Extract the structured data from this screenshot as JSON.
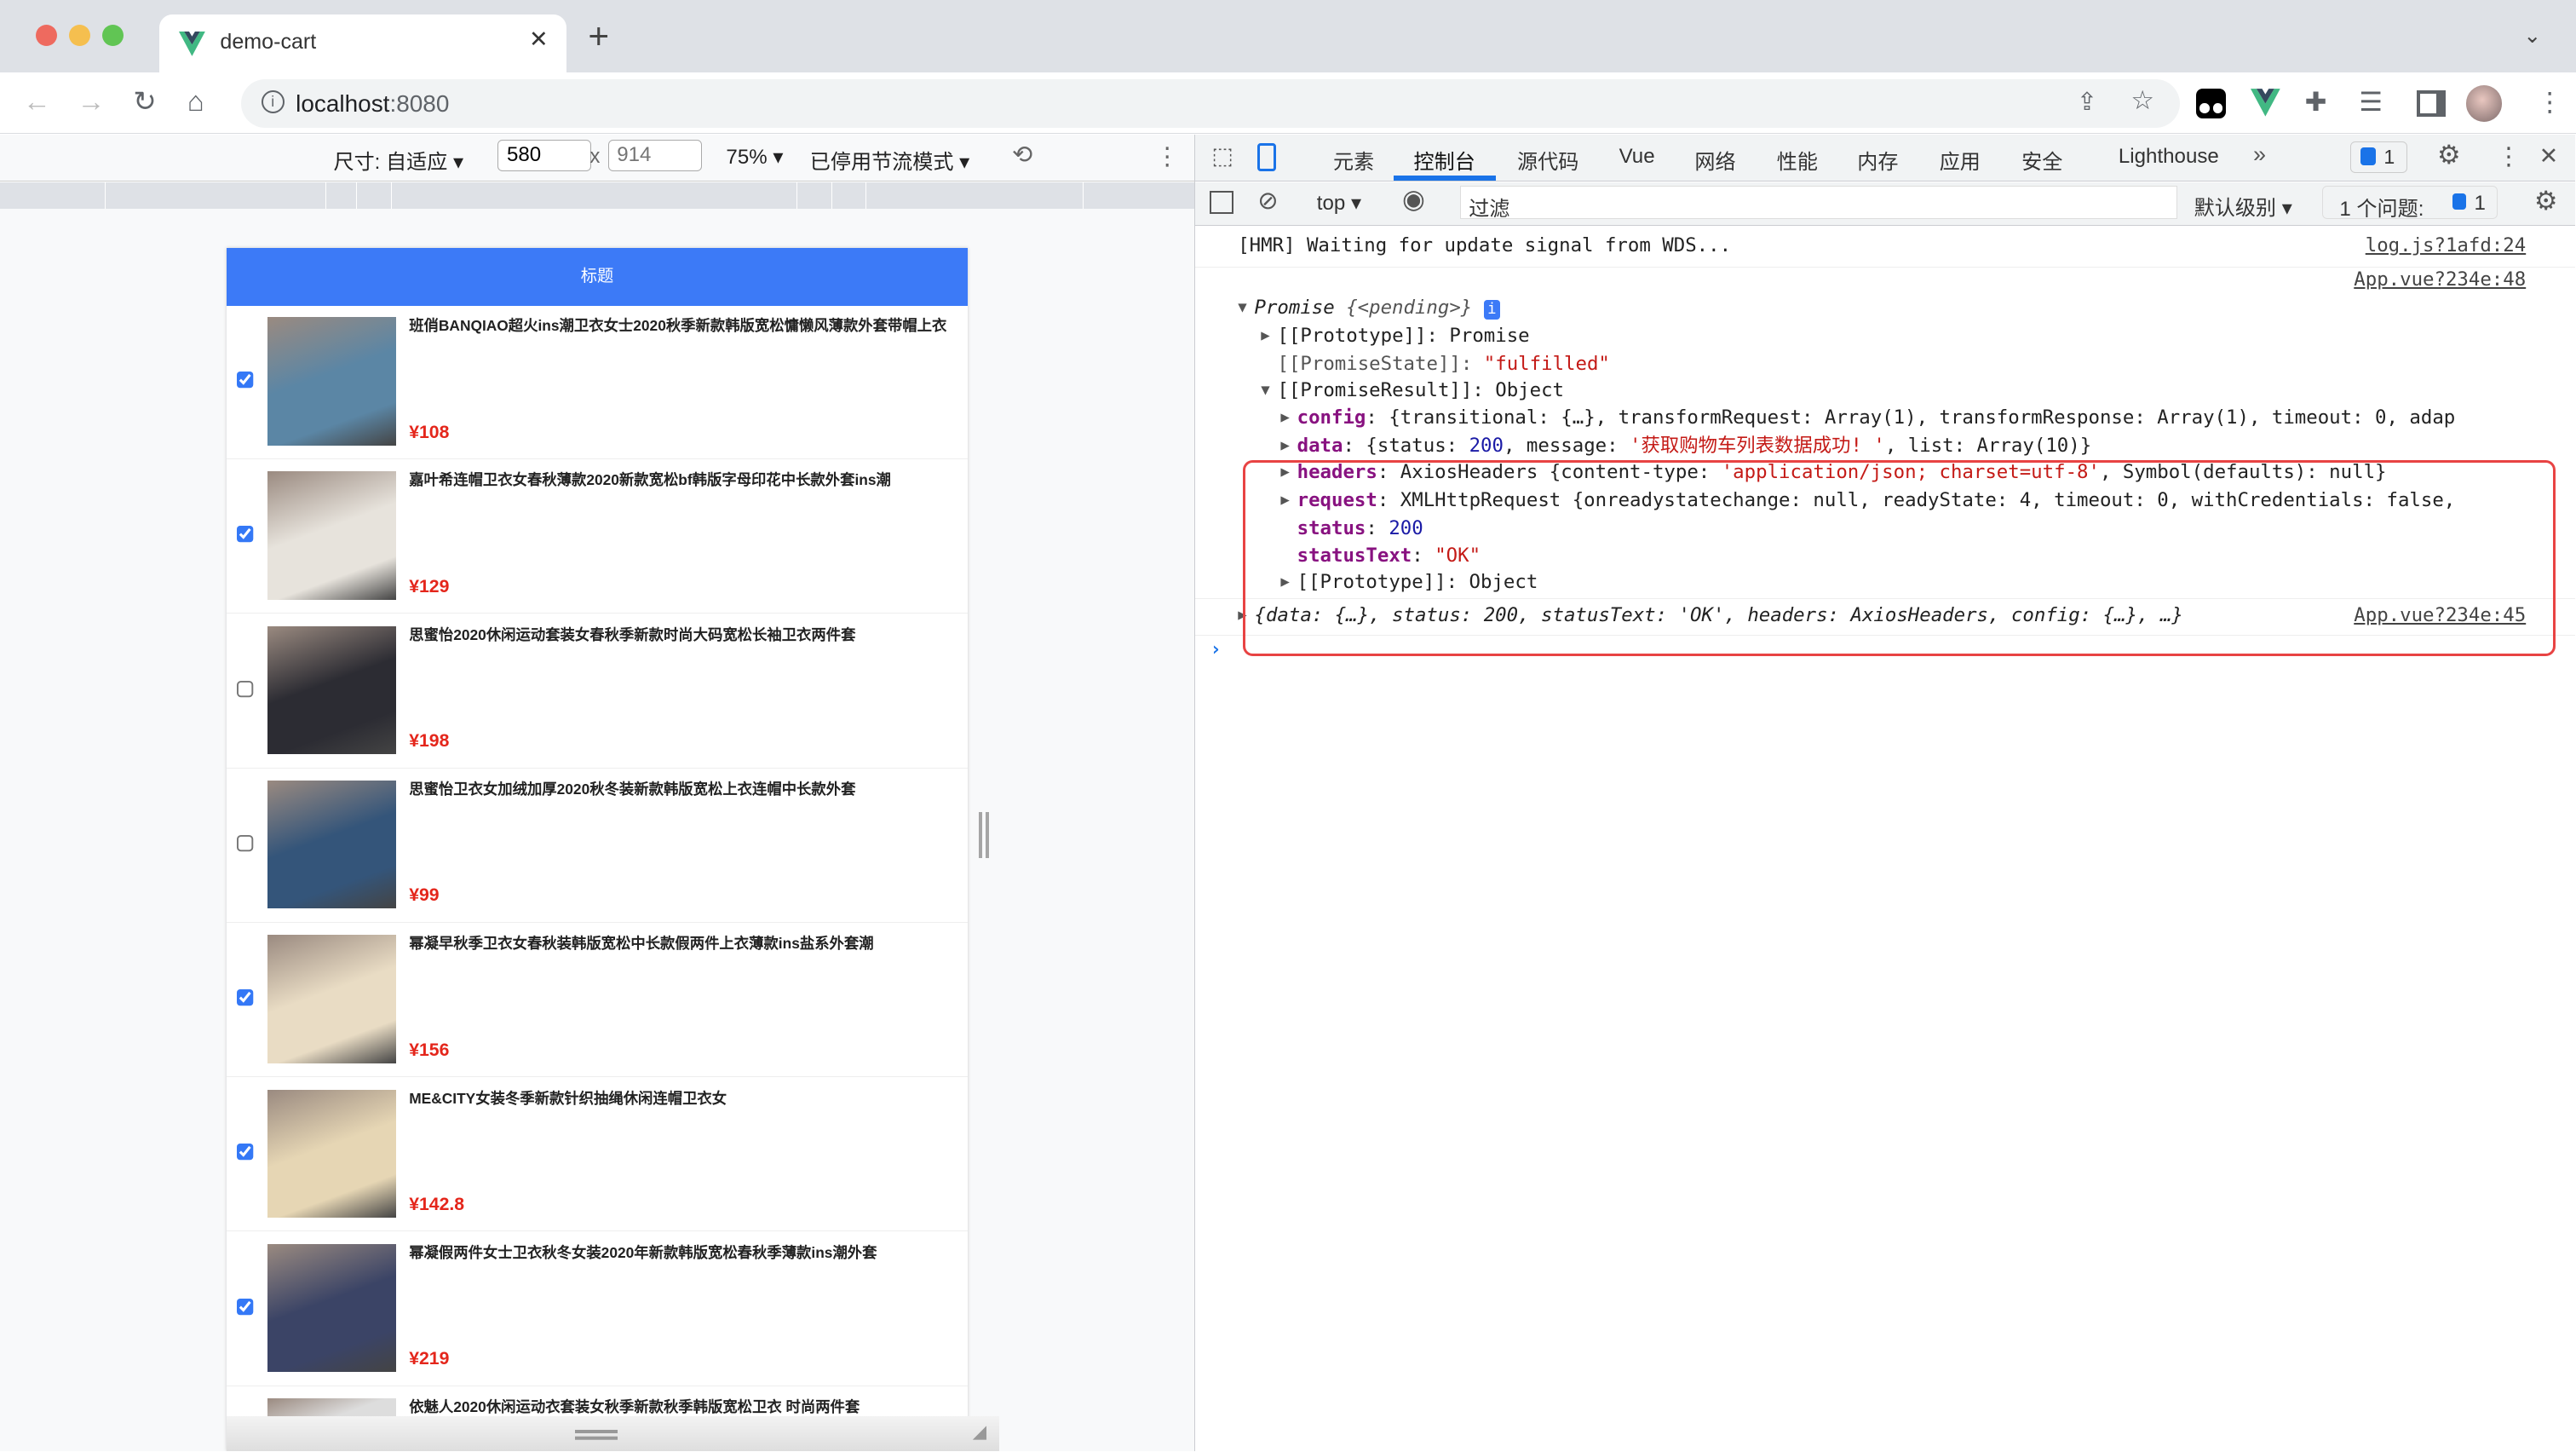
{
  "browser": {
    "tab_title": "demo-cart",
    "url_host": "localhost",
    "url_port": ":8080",
    "icons": [
      "back-arrow-icon",
      "forward-arrow-icon",
      "reload-icon",
      "home-icon",
      "info-icon",
      "share-icon",
      "star-icon",
      "tampermonkey-icon",
      "vue-devtools-icon",
      "extensions-icon",
      "media-icon",
      "sidepanel-icon",
      "avatar",
      "more-vert-icon"
    ]
  },
  "device_toolbar": {
    "size_label": "尺寸: 自适应 ▾",
    "width": "580",
    "times": "x",
    "height_placeholder": "914",
    "zoom": "75% ▾",
    "throttle": "已停用节流模式 ▾"
  },
  "app": {
    "header_title": "标题",
    "items": [
      {
        "name": "班俏BANQIAO超火ins潮卫衣女士2020秋季新款韩版宽松慵懒风薄款外套带帽上衣",
        "price": "¥108",
        "checked": true,
        "color": "#5b86a5"
      },
      {
        "name": "嘉叶希连帽卫衣女春秋薄款2020新款宽松bf韩版字母印花中长款外套ins潮",
        "price": "¥129",
        "checked": true,
        "color": "#e7e3dc"
      },
      {
        "name": "思蜜怡2020休闲运动套装女春秋季新款时尚大码宽松长袖卫衣两件套",
        "price": "¥198",
        "checked": false,
        "color": "#2c2c33"
      },
      {
        "name": "思蜜怡卫衣女加绒加厚2020秋冬装新款韩版宽松上衣连帽中长款外套",
        "price": "¥99",
        "checked": false,
        "color": "#34557a"
      },
      {
        "name": "幂凝早秋季卫衣女春秋装韩版宽松中长款假两件上衣薄款ins盐系外套潮",
        "price": "¥156",
        "checked": true,
        "color": "#e9dcc4"
      },
      {
        "name": "ME&CITY女装冬季新款针织抽绳休闲连帽卫衣女",
        "price": "¥142.8",
        "checked": true,
        "color": "#e6d6b4"
      },
      {
        "name": "幂凝假两件女士卫衣秋冬女装2020年新款韩版宽松春秋季薄款ins潮外套",
        "price": "¥219",
        "checked": true,
        "color": "#3b4466"
      },
      {
        "name": "依魅人2020休闲运动衣套装女秋季新款秋季韩版宽松卫衣 时尚两件套",
        "price": "",
        "checked": false,
        "color": "#ddd"
      }
    ]
  },
  "devtools": {
    "tabs": [
      "元素",
      "控制台",
      "源代码",
      "Vue",
      "网络",
      "性能",
      "内存",
      "应用",
      "安全",
      "Lighthouse"
    ],
    "active_tab": "控制台",
    "more": "»",
    "issues_badge": "1",
    "context": "top ▾",
    "filter_placeholder": "过滤",
    "level": "默认级别 ▾",
    "issues_label": "1 个问题:",
    "issues_count": "1",
    "console": {
      "hmr": "[HMR] Waiting for update signal from WDS...",
      "hmr_src": "log.js?1afd:24",
      "promise_src": "App.vue?234e:48",
      "promise": "Promise",
      "pending": "{<pending>}",
      "proto_promise": "[[Prototype]]: Promise",
      "state_key": "[[PromiseState]]: ",
      "state_val": "\"fulfilled\"",
      "result": "[[PromiseResult]]: Object",
      "config_val": "{transitional: {…}, transformRequest: Array(1), transformResponse: Array(1), timeout: 0, adap",
      "data_pre": "{status: ",
      "data_status": "200",
      "data_mid": ", message: ",
      "data_msg": "'获取购物车列表数据成功! '",
      "data_post": ", list: Array(10)}",
      "headers_pre": "AxiosHeaders {content-type: ",
      "headers_ct": "'application/json; charset=utf-8'",
      "headers_post": ", Symbol(defaults): null}",
      "request_val": "XMLHttpRequest {onreadystatechange: null, readyState: 4, timeout: 0, withCredentials: false,",
      "status": "200",
      "statusText": "\"OK\"",
      "proto_object": "[[Prototype]]: Object",
      "summary": "{data: {…}, status: 200, statusText: 'OK', headers: AxiosHeaders, config: {…}, …}",
      "summary_src": "App.vue?234e:45",
      "prompt": "›"
    },
    "keys": {
      "config": "config",
      "data": "data",
      "headers": "headers",
      "request": "request",
      "status": "status",
      "statusText": "statusText"
    },
    "highlight_color": "#e84343"
  }
}
